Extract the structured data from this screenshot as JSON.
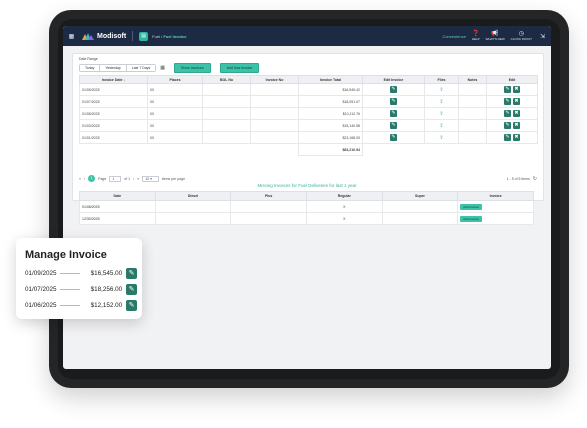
{
  "app": {
    "brand": "Modisoft",
    "breadcrumb_prefix": "Fuel /",
    "breadcrumb_current": "Fuel Invoice",
    "store_name": "Convenience",
    "top_actions": [
      {
        "label": "HELP",
        "icon": "help-icon"
      },
      {
        "label": "WHAT'S NEW",
        "icon": "megaphone-icon"
      },
      {
        "label": "CLOCK IN/OUT",
        "icon": "clock-icon"
      }
    ]
  },
  "filters": {
    "label": "Date Range",
    "ranges": [
      "Today",
      "Yesterday",
      "Last 7 Days"
    ],
    "show_button": "Show Invoices",
    "add_button": "Add Gas Invoice"
  },
  "invoice_table": {
    "columns": [
      "Invoice Date",
      "Places",
      "BOL No",
      "Invoice No",
      "Invoice Total",
      "Edit Invoice",
      "Files",
      "Notes",
      "Edit"
    ],
    "rows": [
      {
        "date": "01/09/2025",
        "place": "00",
        "total": "$16,545.42"
      },
      {
        "date": "01/07/2025",
        "place": "00",
        "total": "$18,051.07"
      },
      {
        "date": "01/05/2025",
        "place": "00",
        "total": "$10,112.76"
      },
      {
        "date": "01/03/2025",
        "place": "00",
        "total": "$15,140.58"
      },
      {
        "date": "01/01/2025",
        "place": "00",
        "total": "$23,168.93"
      }
    ],
    "grand_total": "$83,210.94"
  },
  "pagination": {
    "current_page": "1",
    "page_label": "Page",
    "page_value": "1",
    "of_label": "of 1",
    "per_page": "10",
    "per_page_label": "items per page",
    "summary": "1 - 5 of 5 items"
  },
  "missing": {
    "title": "Missing Invoices for Fuel Deliveries for last 1 year",
    "columns": [
      "Date",
      "Diesel",
      "Plus",
      "Regular",
      "Super",
      "Invoice"
    ],
    "rows": [
      {
        "date": "01/08/2025",
        "regular": "X",
        "action": "Add Invoice"
      },
      {
        "date": "12/30/2025",
        "regular": "X",
        "action": "Add Invoice"
      }
    ]
  },
  "manage_card": {
    "title": "Manage Invoice",
    "rows": [
      {
        "date": "01/09/2025",
        "amount": "$16,545.00"
      },
      {
        "date": "01/07/2025",
        "amount": "$18,256.00"
      },
      {
        "date": "01/06/2025",
        "amount": "$12,152.00"
      }
    ]
  },
  "colors": {
    "accent": "#3cc2a6",
    "dark_teal": "#2a7a6b",
    "header": "#1d2a44",
    "underline": "#e4b54a"
  }
}
